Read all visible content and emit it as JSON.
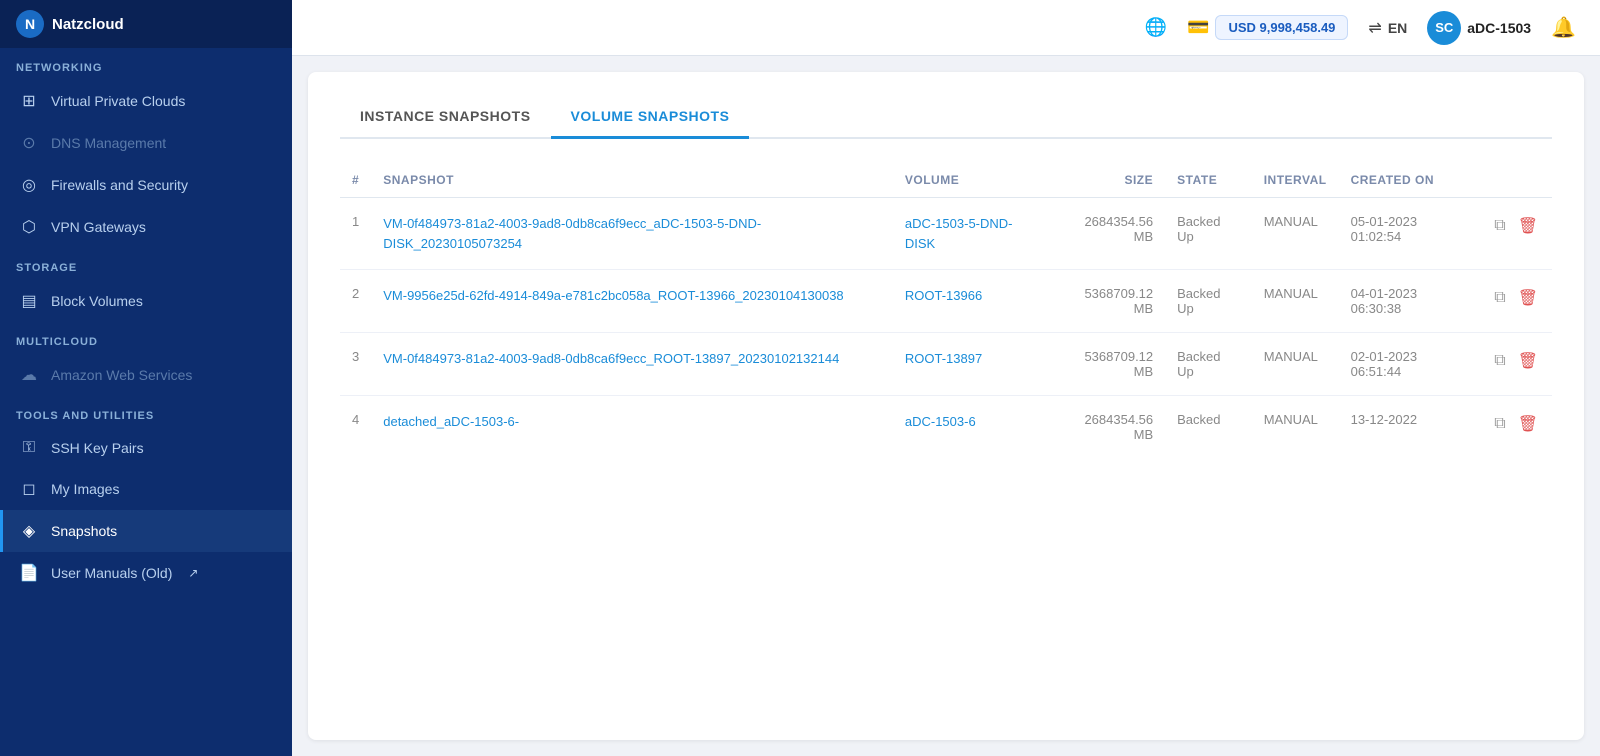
{
  "sidebar": {
    "logo": {
      "initials": "N",
      "title": "Natzcloud"
    },
    "sections": [
      {
        "label": "NETWORKING",
        "items": [
          {
            "id": "virtual-private-clouds",
            "label": "Virtual Private Clouds",
            "icon": "⊞",
            "active": false,
            "disabled": false
          },
          {
            "id": "dns-management",
            "label": "DNS Management",
            "icon": "⊙",
            "active": false,
            "disabled": true
          },
          {
            "id": "firewalls-and-security",
            "label": "Firewalls and Security",
            "icon": "◎",
            "active": false,
            "disabled": false
          },
          {
            "id": "vpn-gateways",
            "label": "VPN Gateways",
            "icon": "⬡",
            "active": false,
            "disabled": false
          }
        ]
      },
      {
        "label": "STORAGE",
        "items": [
          {
            "id": "block-volumes",
            "label": "Block Volumes",
            "icon": "▤",
            "active": false,
            "disabled": false
          }
        ]
      },
      {
        "label": "MULTICLOUD",
        "items": [
          {
            "id": "amazon-web-services",
            "label": "Amazon Web Services",
            "icon": "☁",
            "active": false,
            "disabled": true
          }
        ]
      },
      {
        "label": "TOOLS AND UTILITIES",
        "items": [
          {
            "id": "ssh-key-pairs",
            "label": "SSH Key Pairs",
            "icon": "⚿",
            "active": false,
            "disabled": false
          },
          {
            "id": "my-images",
            "label": "My Images",
            "icon": "◻",
            "active": false,
            "disabled": false
          },
          {
            "id": "snapshots",
            "label": "Snapshots",
            "icon": "◈",
            "active": true,
            "disabled": false
          },
          {
            "id": "user-manuals",
            "label": "User Manuals (Old)",
            "icon": "📄",
            "active": false,
            "disabled": false
          }
        ]
      }
    ]
  },
  "topbar": {
    "balance": "USD 9,998,458.49",
    "language": "EN",
    "username": "aDC-1503",
    "avatar_initials": "SC"
  },
  "tabs": [
    {
      "id": "instance-snapshots",
      "label": "INSTANCE SNAPSHOTS",
      "active": false
    },
    {
      "id": "volume-snapshots",
      "label": "VOLUME SNAPSHOTS",
      "active": true
    }
  ],
  "table": {
    "columns": [
      {
        "id": "num",
        "label": "#"
      },
      {
        "id": "snapshot",
        "label": "SNAPSHOT"
      },
      {
        "id": "volume",
        "label": "VOLUME"
      },
      {
        "id": "size",
        "label": "SIZE"
      },
      {
        "id": "state",
        "label": "STATE"
      },
      {
        "id": "interval",
        "label": "INTERVAL"
      },
      {
        "id": "created_on",
        "label": "CREATED ON"
      },
      {
        "id": "actions",
        "label": ""
      }
    ],
    "rows": [
      {
        "num": "1",
        "snapshot": "VM-0f484973-81a2-4003-9ad8-0db8ca6f9ecc_aDC-1503-5-DND-DISK_20230105073254",
        "volume": "aDC-1503-5-DND-DISK",
        "size": "2684354.56 MB",
        "state": "Backed Up",
        "interval": "MANUAL",
        "created_on": "05-01-2023 01:02:54"
      },
      {
        "num": "2",
        "snapshot": "VM-9956e25d-62fd-4914-849a-e781c2bc058a_ROOT-13966_20230104130038",
        "volume": "ROOT-13966",
        "size": "5368709.12 MB",
        "state": "Backed Up",
        "interval": "MANUAL",
        "created_on": "04-01-2023 06:30:38"
      },
      {
        "num": "3",
        "snapshot": "VM-0f484973-81a2-4003-9ad8-0db8ca6f9ecc_ROOT-13897_20230102132144",
        "volume": "ROOT-13897",
        "size": "5368709.12 MB",
        "state": "Backed Up",
        "interval": "MANUAL",
        "created_on": "02-01-2023 06:51:44"
      },
      {
        "num": "4",
        "snapshot": "detached_aDC-1503-6-",
        "volume": "aDC-1503-6",
        "size": "2684354.56 MB",
        "state": "Backed",
        "interval": "MANUAL",
        "created_on": "13-12-2022"
      }
    ]
  }
}
